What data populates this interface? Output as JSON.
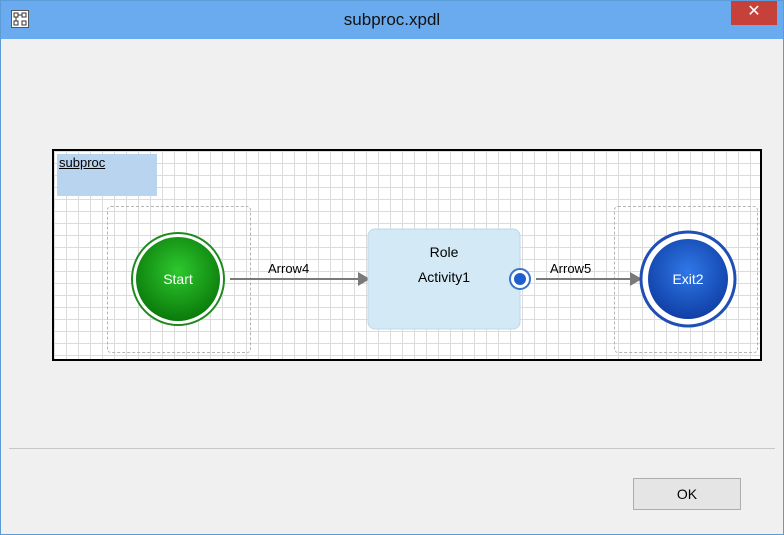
{
  "window": {
    "title": "subproc.xpdl",
    "close_label": "✕",
    "app_icon": "diagram-icon"
  },
  "diagram": {
    "pool_label": "subproc",
    "nodes": {
      "start": {
        "label": "Start",
        "color": "#2aa82a"
      },
      "activity": {
        "line1": "Role",
        "line2": "Activity1",
        "color": "#d3e9f6"
      },
      "exit": {
        "label": "Exit2",
        "color": "#1f5fd6"
      }
    },
    "edges": {
      "arrow4": "Arrow4",
      "arrow5": "Arrow5"
    }
  },
  "footer": {
    "ok_label": "OK"
  }
}
